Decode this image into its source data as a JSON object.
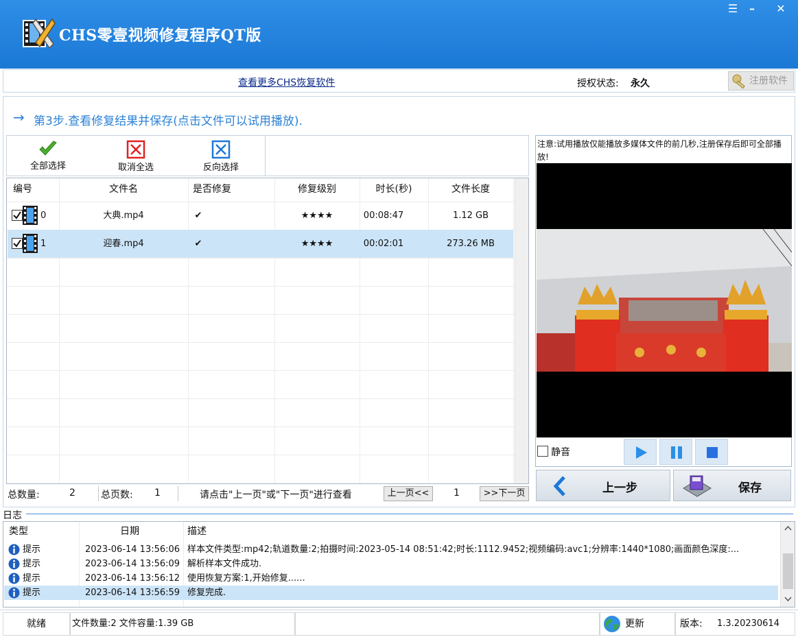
{
  "window": {
    "title": "CHS零壹视频修复程序QT版",
    "menu_glyph": "☰",
    "minimize_glyph": "–",
    "close_glyph": "✕"
  },
  "topbar": {
    "more_link": "查看更多CHS恢复软件",
    "auth_label": "授权状态:",
    "auth_value": "永久",
    "register_label": "注册软件"
  },
  "step": {
    "arrow": "→",
    "text": "第3步.查看修复结果并保存(点击文件可以试用播放)."
  },
  "toolbar": {
    "select_all": "全部选择",
    "deselect_all": "取消全选",
    "invert_select": "反向选择"
  },
  "grid": {
    "columns": [
      "编号",
      "文件名",
      "是否修复",
      "修复级别",
      "时长(秒)",
      "文件长度"
    ],
    "rows": [
      {
        "id": "0",
        "name": "大典.mp4",
        "repaired": "✔",
        "level": "★★★★",
        "duration": "00:08:47",
        "size": "1.12 GB",
        "checked": true,
        "selected": false
      },
      {
        "id": "1",
        "name": "迎春.mp4",
        "repaired": "✔",
        "level": "★★★★",
        "duration": "00:02:01",
        "size": "273.26 MB",
        "checked": true,
        "selected": true
      }
    ]
  },
  "pager": {
    "total_label": "总数量:",
    "total_value": "2",
    "pages_label": "总页数:",
    "pages_value": "1",
    "hint": "请点击\"上一页\"或\"下一页\"进行查看",
    "prev_label": "上一页<<",
    "current_page": "1",
    "next_label": ">>下一页"
  },
  "preview": {
    "notice": "注意:试用播放仅能播放多媒体文件的前几秒,注册保存后即可全部播放!",
    "mute_label": "静音"
  },
  "nav": {
    "back_label": "上一步",
    "save_label": "保存"
  },
  "log": {
    "title": "日志",
    "columns": [
      "类型",
      "日期",
      "描述"
    ],
    "rows": [
      {
        "type": "提示",
        "date": "2023-06-14 13:56:06",
        "desc": "样本文件类型:mp42;轨道数量:2;拍摄时间:2023-05-14 08:51:42;时长:1112.9452;视频编码:avc1;分辨率:1440*1080;画面颜色深度:...",
        "selected": false
      },
      {
        "type": "提示",
        "date": "2023-06-14 13:56:09",
        "desc": "解析样本文件成功.",
        "selected": false
      },
      {
        "type": "提示",
        "date": "2023-06-14 13:56:12",
        "desc": "使用恢复方案:1,开始修复......",
        "selected": false
      },
      {
        "type": "提示",
        "date": "2023-06-14 13:56:59",
        "desc": "修复完成.",
        "selected": true
      }
    ]
  },
  "status": {
    "ready": "就绪",
    "file_summary": "文件数量:2 文件容量:1.39 GB",
    "update_label": "更新",
    "version_label": "版本:",
    "version_value": "1.3.20230614"
  },
  "colors": {
    "title_blue": "#1f80dc",
    "accent_blue": "#2c82d6",
    "selection": "#cce4f7"
  },
  "icons": {
    "app": "video-repair-logo-icon",
    "select_all": "green-check-icon",
    "deselect_all": "red-x-box-icon",
    "invert": "blue-x-box-icon",
    "file": "film-strip-icon",
    "info": "info-icon",
    "update": "globe-icon",
    "save": "floppy-disk-icon"
  }
}
